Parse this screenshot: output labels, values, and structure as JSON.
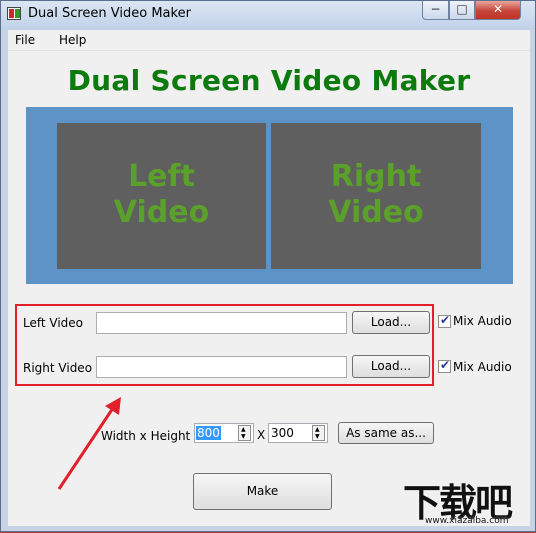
{
  "window": {
    "title": "Dual Screen Video Maker",
    "controls": {
      "minimize": "−",
      "maximize": "□",
      "close": "✕"
    }
  },
  "menu": [
    "File",
    "Help"
  ],
  "heading": "Dual Screen Video Maker",
  "preview": {
    "left": {
      "line1": "Left",
      "line2": "Video"
    },
    "right": {
      "line1": "Right",
      "line2": "Video"
    }
  },
  "rows": {
    "left": {
      "label": "Left Video",
      "value": "",
      "load_label": "Load...",
      "mix_label": "Mix Audio",
      "mix_checked": true
    },
    "right": {
      "label": "Right Video",
      "value": "",
      "load_label": "Load...",
      "mix_label": "Mix Audio",
      "mix_checked": true
    }
  },
  "size": {
    "label": "Width x Height",
    "width": "800",
    "separator": "X",
    "height": "300",
    "same_as_label": "As same as..."
  },
  "make_label": "Make",
  "watermark": {
    "main": "下载吧",
    "sub": "www.xiazaiba.com"
  },
  "colors": {
    "heading": "#0d7a0d",
    "preview_bg": "#5e93c7",
    "pane_bg": "#5f5f5f",
    "pane_text": "#5ca02c",
    "highlight": "#e0212b"
  },
  "icons": [
    "app-icon",
    "checkmark-icon",
    "spin-up-icon",
    "spin-down-icon",
    "annotation-arrow-icon"
  ]
}
